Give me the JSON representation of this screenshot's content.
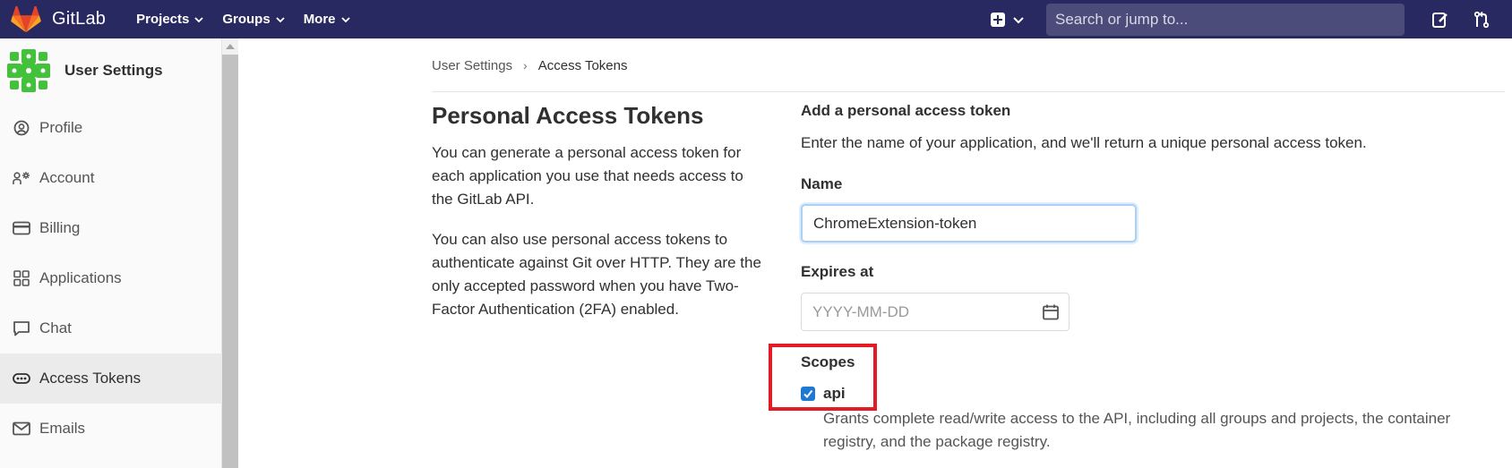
{
  "navbar": {
    "brand": "GitLab",
    "items": [
      {
        "label": "Projects"
      },
      {
        "label": "Groups"
      },
      {
        "label": "More"
      }
    ],
    "search_placeholder": "Search or jump to...",
    "icons": [
      "plus-square-icon",
      "chevron-down-icon",
      "todo-icon",
      "merge-request-icon"
    ],
    "background": "#292961"
  },
  "sidebar": {
    "title": "User Settings",
    "items": [
      {
        "label": "Profile",
        "icon": "profile-icon"
      },
      {
        "label": "Account",
        "icon": "account-icon"
      },
      {
        "label": "Billing",
        "icon": "billing-icon"
      },
      {
        "label": "Applications",
        "icon": "applications-icon"
      },
      {
        "label": "Chat",
        "icon": "chat-icon"
      },
      {
        "label": "Access Tokens",
        "icon": "token-icon",
        "active": true
      },
      {
        "label": "Emails",
        "icon": "mail-icon"
      }
    ]
  },
  "breadcrumb": {
    "parent": "User Settings",
    "separator": "›",
    "current": "Access Tokens"
  },
  "main": {
    "title": "Personal Access Tokens",
    "paragraph1": "You can generate a personal access token for each application you use that needs access to the GitLab API.",
    "paragraph2": "You can also use personal access tokens to authenticate against Git over HTTP. They are the only accepted password when you have Two-Factor Authentication (2FA) enabled."
  },
  "form": {
    "section_title": "Add a personal access token",
    "description": "Enter the name of your application, and we'll return a unique personal access token.",
    "name_label": "Name",
    "name_value": "ChromeExtension-token",
    "expires_label": "Expires at",
    "expires_placeholder": "YYYY-MM-DD",
    "scopes_label": "Scopes",
    "scopes": [
      {
        "label": "api",
        "checked": true,
        "help": "Grants complete read/write access to the API, including all groups and projects, the container registry, and the package registry."
      }
    ],
    "highlight_color": "#e21b24"
  }
}
